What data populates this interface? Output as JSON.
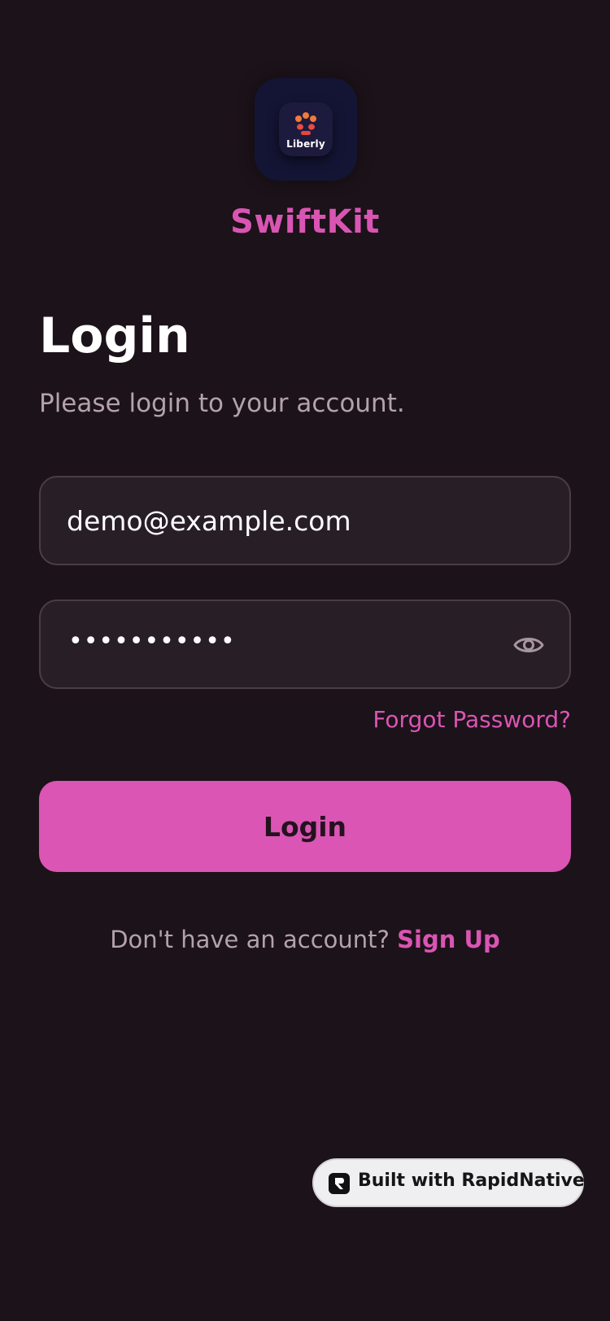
{
  "app_icon": {
    "label": "Liberly",
    "icon": "paw-icon",
    "colors": {
      "background": "#141535",
      "paw": "#f0623d"
    }
  },
  "brand": {
    "name": "SwiftKit",
    "color": "#d955b3"
  },
  "header": {
    "title": "Login",
    "subtitle": "Please login to your account."
  },
  "form": {
    "email": {
      "value": "demo@example.com",
      "placeholder": ""
    },
    "password": {
      "masked_value": "•••••••••••",
      "toggle_icon": "eye-icon"
    },
    "forgot_password": "Forgot Password?",
    "submit_label": "Login"
  },
  "footer": {
    "prompt": "Don't have an account?",
    "signup_label": "Sign Up"
  },
  "badge": {
    "label": "Built with RapidNative",
    "icon": "rapidnative-logo-icon"
  },
  "colors": {
    "background": "#1c1219",
    "accent": "#d955b3",
    "field_bg": "#281e26",
    "field_border": "#4a3d46",
    "muted_text": "#b3a2ad"
  }
}
